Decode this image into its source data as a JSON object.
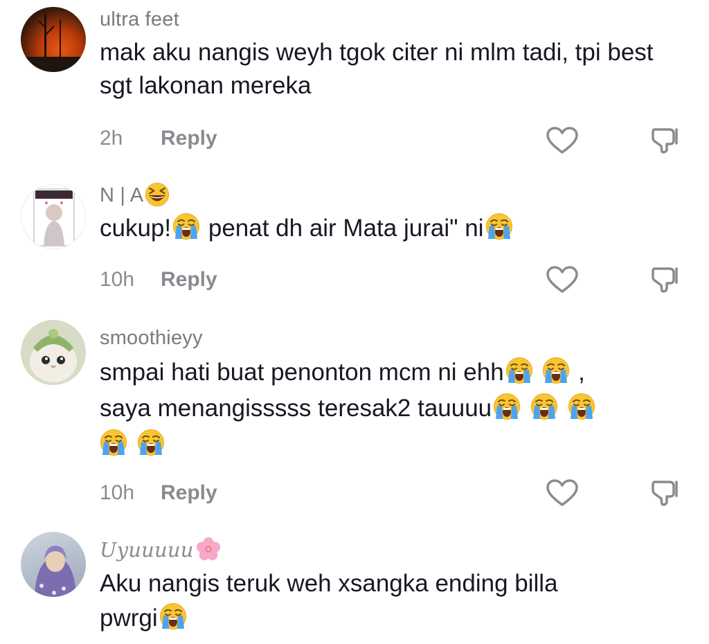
{
  "comments": [
    {
      "username": "ultra feet",
      "text": "mak aku nangis weyh tgok citer ni mlm tadi, tpi best sgt lakonan mereka",
      "time": "2h",
      "reply_label": "Reply"
    },
    {
      "username": "N | A",
      "username_emoji": "grinning-squinting-face",
      "text_parts": [
        "cukup!",
        " penat dh air Mata jurai\" ni"
      ],
      "emoji": "loudly-crying-face",
      "time": "10h",
      "reply_label": "Reply"
    },
    {
      "username": "smoothieyy",
      "line1": "smpai hati buat penonton mcm ni ehh",
      "line1_end": ",",
      "line2": "saya menangisssss teresak2 tauuuu",
      "emoji": "loudly-crying-face",
      "time": "10h",
      "reply_label": "Reply"
    },
    {
      "username": "Uyuuuuu",
      "username_emoji": "cherry-blossom",
      "line1": "Aku nangis teruk weh xsangka ending billa",
      "line2": "pwrgi",
      "emoji": "loudly-crying-face"
    }
  ],
  "icons": {
    "like": "heart-outline-icon",
    "dislike": "thumbs-down-outline-icon"
  },
  "colors": {
    "text": "#161823",
    "muted": "#8a8a90",
    "emoji_yellow": "#f9c531",
    "tears_blue": "#4da3f0"
  }
}
